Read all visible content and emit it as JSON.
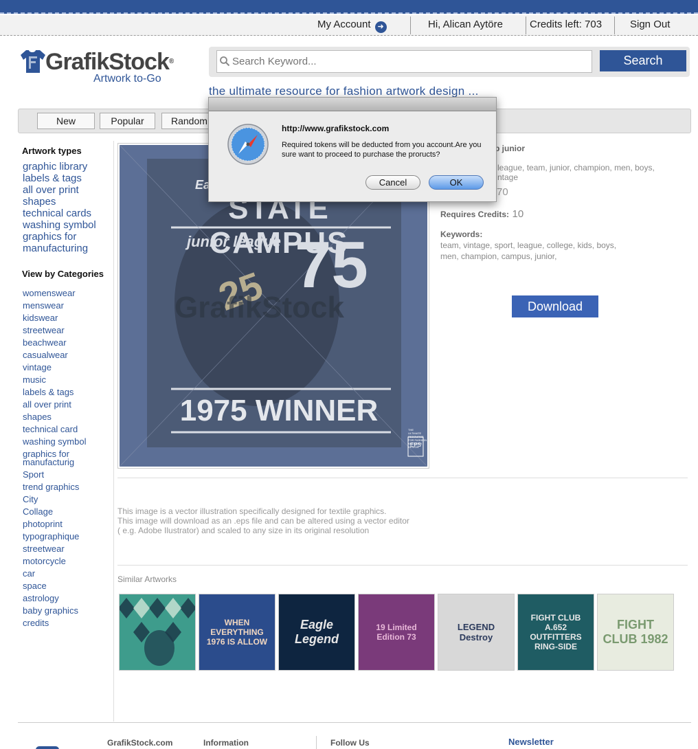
{
  "topbar": {
    "my_account": "My Account",
    "greeting": "Hi, Alican Aytöre",
    "credits": "Credits left: 703",
    "sign_out": "Sign Out"
  },
  "header": {
    "logo_main": "GrafikStock",
    "logo_reg": "®",
    "logo_sub": "Artwork to-Go",
    "search_placeholder": "Search Keyword...",
    "search_button": "Search",
    "tagline": "the ultimate resource for fashion artwork design ..."
  },
  "nav": {
    "new": "New",
    "popular": "Popular",
    "random": "Random"
  },
  "sidebar": {
    "artwork_types_title": "Artwork types",
    "artwork_types": [
      "graphic library",
      "labels & tags",
      "all over print",
      "shapes",
      "technical cards",
      "washing symbol",
      "graphics for",
      "manufacturing"
    ],
    "categories_title": "View by Categories",
    "categories": [
      "womenswear",
      "menswear",
      "kidswear",
      "streetwear",
      "beachwear",
      "casualwear",
      "vintage",
      "music",
      "labels & tags",
      "all over print",
      "shapes",
      "technical card",
      "washing symbol",
      "graphics for manufacturig",
      "Sport",
      "trend graphics",
      "City",
      "Collage",
      "photoprint",
      "typographique",
      "streetwear",
      "motorcycle",
      "car",
      "space",
      "astrology",
      "baby graphics",
      "credits"
    ]
  },
  "artwork": {
    "line1": "STATE CAMPUS",
    "line2": "junior league",
    "number": "75",
    "jersey": "25",
    "winner": "1975 WINNER",
    "watermark": "GrafikStock",
    "corner_text": "THE ULTIMATE RESOURCE FOR FASHION ARTWORK DESIGN",
    "eps": "EPS",
    "partial_top": "Ea"
  },
  "details": {
    "title_partial": "p junior",
    "tags_partial_line1": "league, team, junior, champion, men, boys,",
    "tags_partial_line2": "ntage",
    "code_partial": "70",
    "requires_credits_label": "Requires Credits:",
    "requires_credits_value": "10",
    "keywords_label": "Keywords:",
    "keywords_line1": "team,  vintage,  sport,  league,  college,  kids,  boys,",
    "keywords_line2": "men,  champion,  campus,  junior,",
    "download": "Download"
  },
  "description": {
    "line1": "This image is a vector illustration specifically designed for textile graphics.",
    "line2": "This image will download as an .eps file and can be altered using a vector editor",
    "line3": "( e.g. Adobe Ilustrator) and scaled to any size in its original resolution"
  },
  "similar": {
    "title": "Similar Artworks",
    "items": [
      {
        "text": "",
        "bg": "#3e9c8c"
      },
      {
        "text": "WHEN EVERYTHING 1976 IS ALLOW",
        "bg": "#2b4c8c"
      },
      {
        "text": "Eagle Legend",
        "bg": "#0e2540"
      },
      {
        "text": "19 Limited Edition 73",
        "bg": "#7a3a7a"
      },
      {
        "text": "LEGEND Destroy",
        "bg": "#d8d8d8"
      },
      {
        "text": "FIGHT CLUB A.652 OUTFITTERS RING-SIDE",
        "bg": "#1f5c63"
      },
      {
        "text": "FIGHT CLUB 1982",
        "bg": "#e8ece0"
      }
    ]
  },
  "footer": {
    "col1": "GrafikStock.com",
    "col2": "Information",
    "col3": "Follow Us",
    "col4": "Newsletter"
  },
  "dialog": {
    "title": "http://www.grafikstock.com",
    "message": "Required tokens will be deducted from you account.Are you sure want to proceed to purchase the proructs?",
    "cancel": "Cancel",
    "ok": "OK"
  },
  "colors": {
    "brand_blue": "#2f5597",
    "download_blue": "#3b63b5",
    "link_blue": "#2f5597"
  }
}
